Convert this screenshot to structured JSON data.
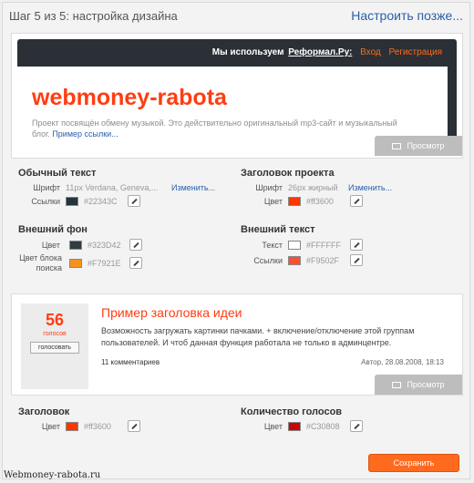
{
  "header": {
    "step_title": "Шаг 5 из 5: настройка дизайна",
    "later_link": "Настроить позже..."
  },
  "preview_site": {
    "bar_text": "Мы используем",
    "bar_ref": "Реформал.Ру:",
    "login": "Вход",
    "register": "Регистрация",
    "logo": "webmoney-rabota",
    "description": "Проект посвящён обмену музыкой. Это действительно оригинальный mp3-сайт и музыкальный блог.",
    "example_link": "Пример ссылки...",
    "preview_button": "Просмотр"
  },
  "normal_text": {
    "title": "Обычный текст",
    "font_label": "Шрифт",
    "font_value": "11px Verdana, Geneva,...",
    "change_link": "Изменить...",
    "links_label": "Ссылки",
    "links_color": "#22343C"
  },
  "project_title": {
    "title": "Заголовок проекта",
    "font_label": "Шрифт",
    "font_value": "26px жирный",
    "change_link": "Изменить...",
    "color_label": "Цвет",
    "color_value": "#ff3600"
  },
  "outer_background": {
    "title": "Внешний фон",
    "color_label": "Цвет",
    "color_value": "#323D42",
    "search_label": "Цвет блока поиска",
    "search_value": "#F7921E"
  },
  "outer_text": {
    "title": "Внешний текст",
    "text_label": "Текст",
    "text_value": "#FFFFFF",
    "links_label": "Ссылки",
    "links_value": "#F9502F"
  },
  "preview_idea": {
    "votes": "56",
    "votes_word": "голосов",
    "vote_button": "голосовать",
    "title": "Пример заголовка идеи",
    "text": "Возможность загружать картинки пачками. + включение/отключение этой группам пользователей. И чтоб данная функция работала не только в админцентре.",
    "comments": "11 комментариев",
    "author": "Автор, 28.08.2008, 18:13",
    "preview_button": "Просмотр"
  },
  "heading": {
    "title": "Заголовок",
    "color_label": "Цвет",
    "color_value": "#ff3600"
  },
  "votes_count": {
    "title": "Количество голосов",
    "color_label": "Цвет",
    "color_value": "#C30808"
  },
  "save_button": "Сохранить",
  "watermark": "Webmoney-rabota.ru",
  "swatch_colors": {
    "links": "#22343C",
    "project_title": "#ff3600",
    "outer_bg": "#323D42",
    "search_block": "#F7921E",
    "outer_text": "#FFFFFF",
    "outer_links": "#F9502F",
    "heading": "#ff3600",
    "votes": "#C30808"
  }
}
